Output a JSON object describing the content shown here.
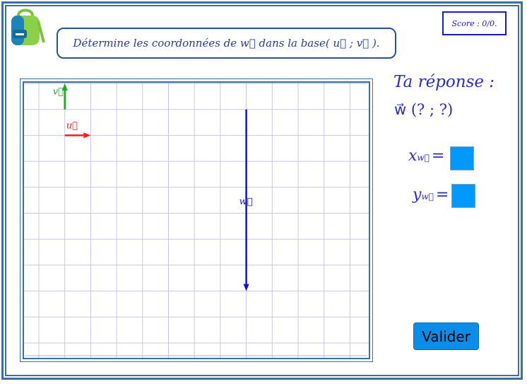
{
  "score": {
    "text": "Score : 0/0."
  },
  "question": {
    "text": "Détermine les coordonnées de w⃗ dans la base( u⃗ ; v⃗ )."
  },
  "board": {
    "vectors": [
      {
        "name": "u",
        "label": "u⃗",
        "color": "#ff1a1a",
        "from": [
          1,
          8
        ],
        "to": [
          2,
          8
        ]
      },
      {
        "name": "v",
        "label": "v⃗",
        "color": "#1aaa1a",
        "from": [
          1,
          9
        ],
        "to": [
          1,
          10
        ]
      },
      {
        "name": "w",
        "label": "w⃗",
        "color": "#1010d8",
        "from": [
          8,
          9
        ],
        "to": [
          8,
          2
        ]
      }
    ],
    "grid_color": "#c9c4ef"
  },
  "answer": {
    "title": "Ta réponse :",
    "coords": "w⃗ (? ; ?)",
    "x_label": "x",
    "y_label": "y",
    "sub": "w⃗",
    "eq": "=",
    "input_color": "#0099ff"
  },
  "validate_label": "Valider",
  "icons": {
    "logo": "backpack-icon"
  }
}
